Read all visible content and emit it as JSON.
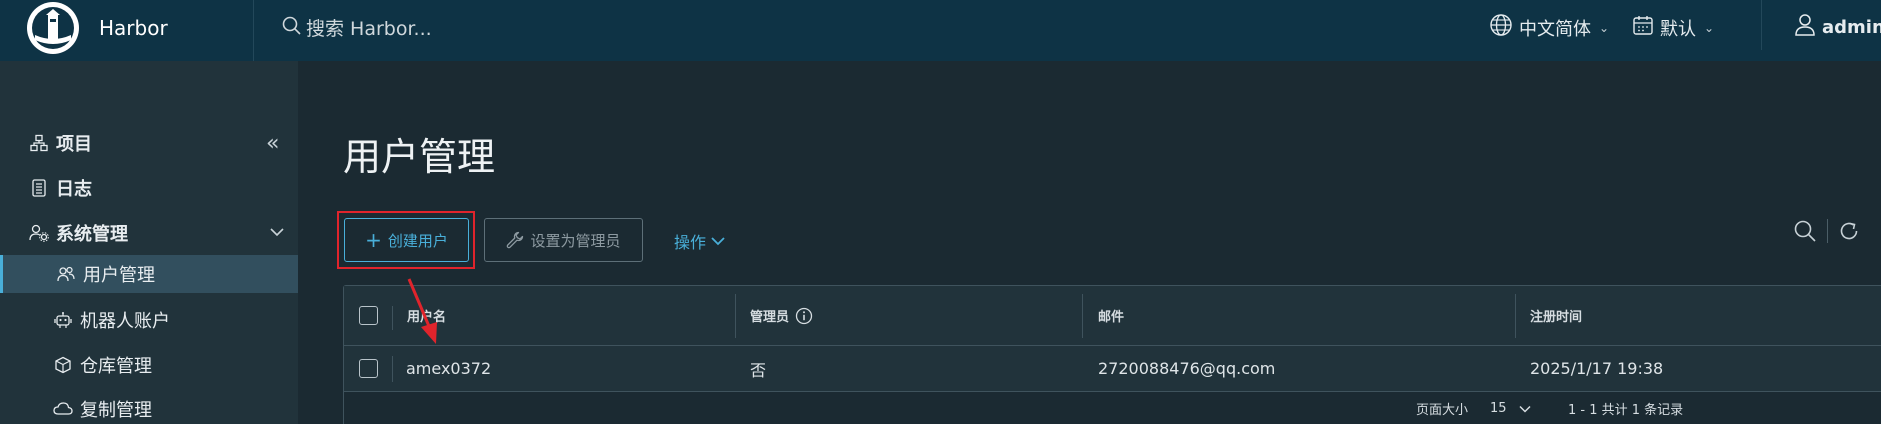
{
  "header": {
    "brand": "Harbor",
    "search_placeholder": "搜索 Harbor...",
    "language": "中文简体",
    "date_format": "默认",
    "user": "admin"
  },
  "sidebar": {
    "items": [
      {
        "label": "项目",
        "icon": "project-icon"
      },
      {
        "label": "日志",
        "icon": "log-icon"
      },
      {
        "label": "系统管理",
        "icon": "system-admin-icon"
      },
      {
        "label": "用户管理",
        "icon": "users-icon"
      },
      {
        "label": "机器人账户",
        "icon": "robot-icon"
      },
      {
        "label": "仓库管理",
        "icon": "cube-icon"
      },
      {
        "label": "复制管理",
        "icon": "cloud-icon"
      }
    ]
  },
  "main": {
    "title": "用户管理",
    "create_user_label": "创建用户",
    "set_admin_label": "设置为管理员",
    "actions_label": "操作"
  },
  "table": {
    "headers": [
      "用户名",
      "管理员",
      "邮件",
      "注册时间"
    ],
    "rows": [
      {
        "username": "amex0372",
        "admin": "否",
        "email": "2720088476@qq.com",
        "registered": "2025/1/17 19:38"
      }
    ],
    "footer": {
      "page_size_label": "页面大小",
      "page_size_value": "15",
      "summary": "1 - 1 共计 1 条记录"
    }
  },
  "colors": {
    "header_bg": "#0e3345",
    "accent": "#49afd9",
    "highlight_box": "#e0242c"
  }
}
